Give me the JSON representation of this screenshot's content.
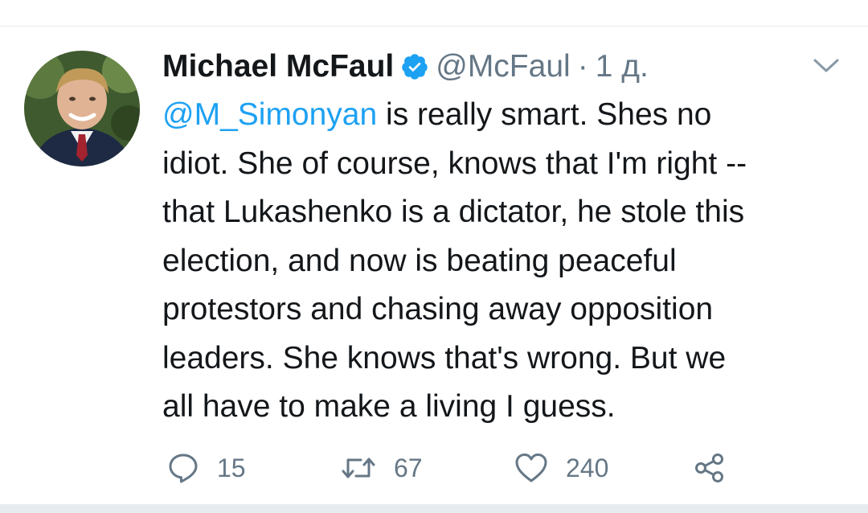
{
  "tweet": {
    "display_name": "Michael McFaul",
    "handle": "@McFaul",
    "separator": "·",
    "time": "1 д.",
    "mention": "@M_Simonyan",
    "text_lines": [
      " is really smart. Shes no",
      "idiot. She of course, knows that I'm right --",
      "that Lukashenko is a dictator, he stole this",
      "election, and now is beating peaceful",
      "protestors and chasing away opposition",
      "leaders. She knows that's wrong.  But we",
      "all have to make a living I guess."
    ],
    "counts": {
      "replies": "15",
      "retweets": "67",
      "likes": "240"
    }
  },
  "icons": {
    "verified": "verified-badge-icon",
    "caret": "chevron-down-icon",
    "reply": "reply-icon",
    "retweet": "retweet-icon",
    "like": "heart-icon",
    "share": "share-icon"
  },
  "colors": {
    "link": "#1da1f2",
    "muted": "#657786",
    "text": "#14171a",
    "divider": "#e6ecf0"
  }
}
